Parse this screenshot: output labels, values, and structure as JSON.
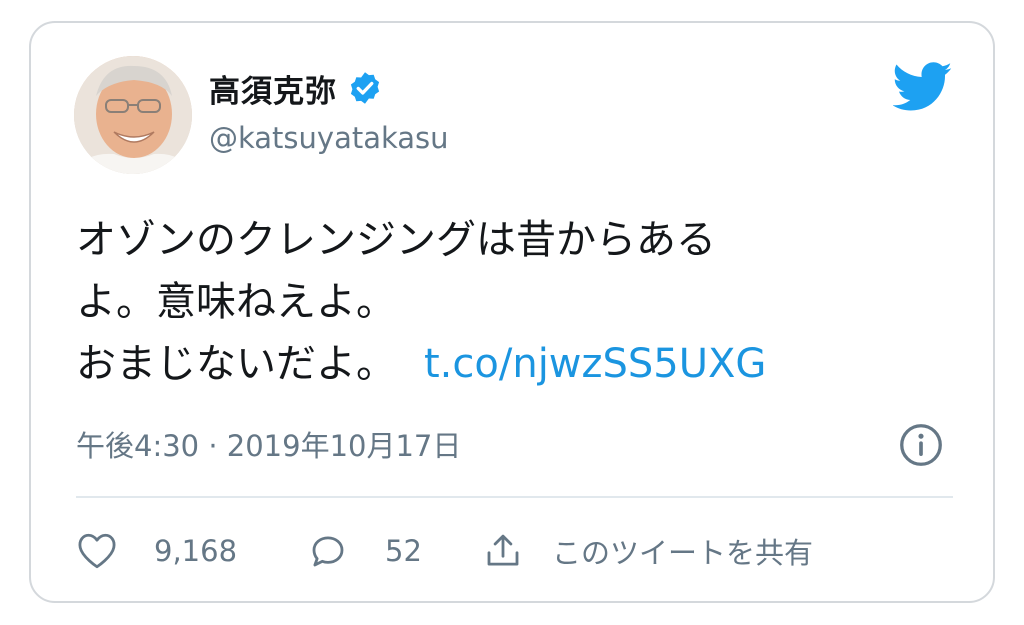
{
  "user": {
    "display_name": "高須克弥",
    "handle": "@katsuyatakasu",
    "verified": true
  },
  "tweet": {
    "lines": [
      "オゾンのクレンジングは昔からある",
      "よ。意味ねえよ。",
      "おまじないだよ。"
    ],
    "link_text": "t.co/njwzSS5UXG",
    "timestamp": "午後4:30 · 2019年10月17日"
  },
  "actions": {
    "likes": "9,168",
    "replies": "52",
    "share_label": "このツイートを共有"
  },
  "icons": {
    "brand": "twitter-bird-icon",
    "verified": "verified-badge-icon",
    "info": "info-icon",
    "like": "heart-icon",
    "reply": "reply-bubble-icon",
    "share": "share-icon"
  },
  "colors": {
    "brand": "#1da1f2",
    "link": "#1b95e0",
    "muted": "#657786",
    "text": "#14171a",
    "border": "#d4d8dc"
  }
}
